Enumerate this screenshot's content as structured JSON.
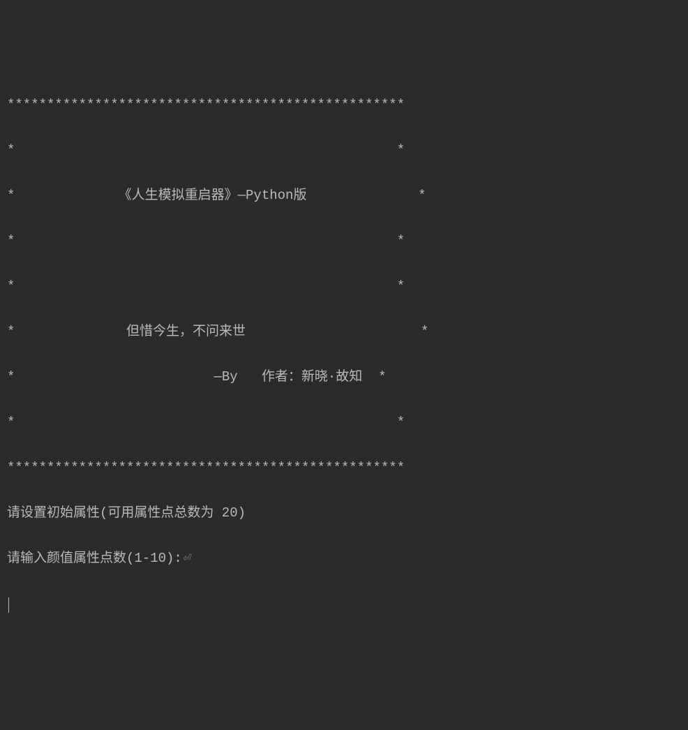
{
  "terminal": {
    "border_top": "**************************************************",
    "blank_row": "*                                                *",
    "title_row": "*             《人生模拟重启器》—Python版              *",
    "motto_row": "*              但惜今生，不问来世                      *",
    "author_row": "*                         —By   作者：新晓·故知  *",
    "border_bottom": "**************************************************",
    "prompt_set_attr": "请设置初始属性(可用属性点总数为 20)",
    "prompt_input_appearance": "请输入颜值属性点数(1-10):",
    "newline_indicator": "⏎"
  }
}
